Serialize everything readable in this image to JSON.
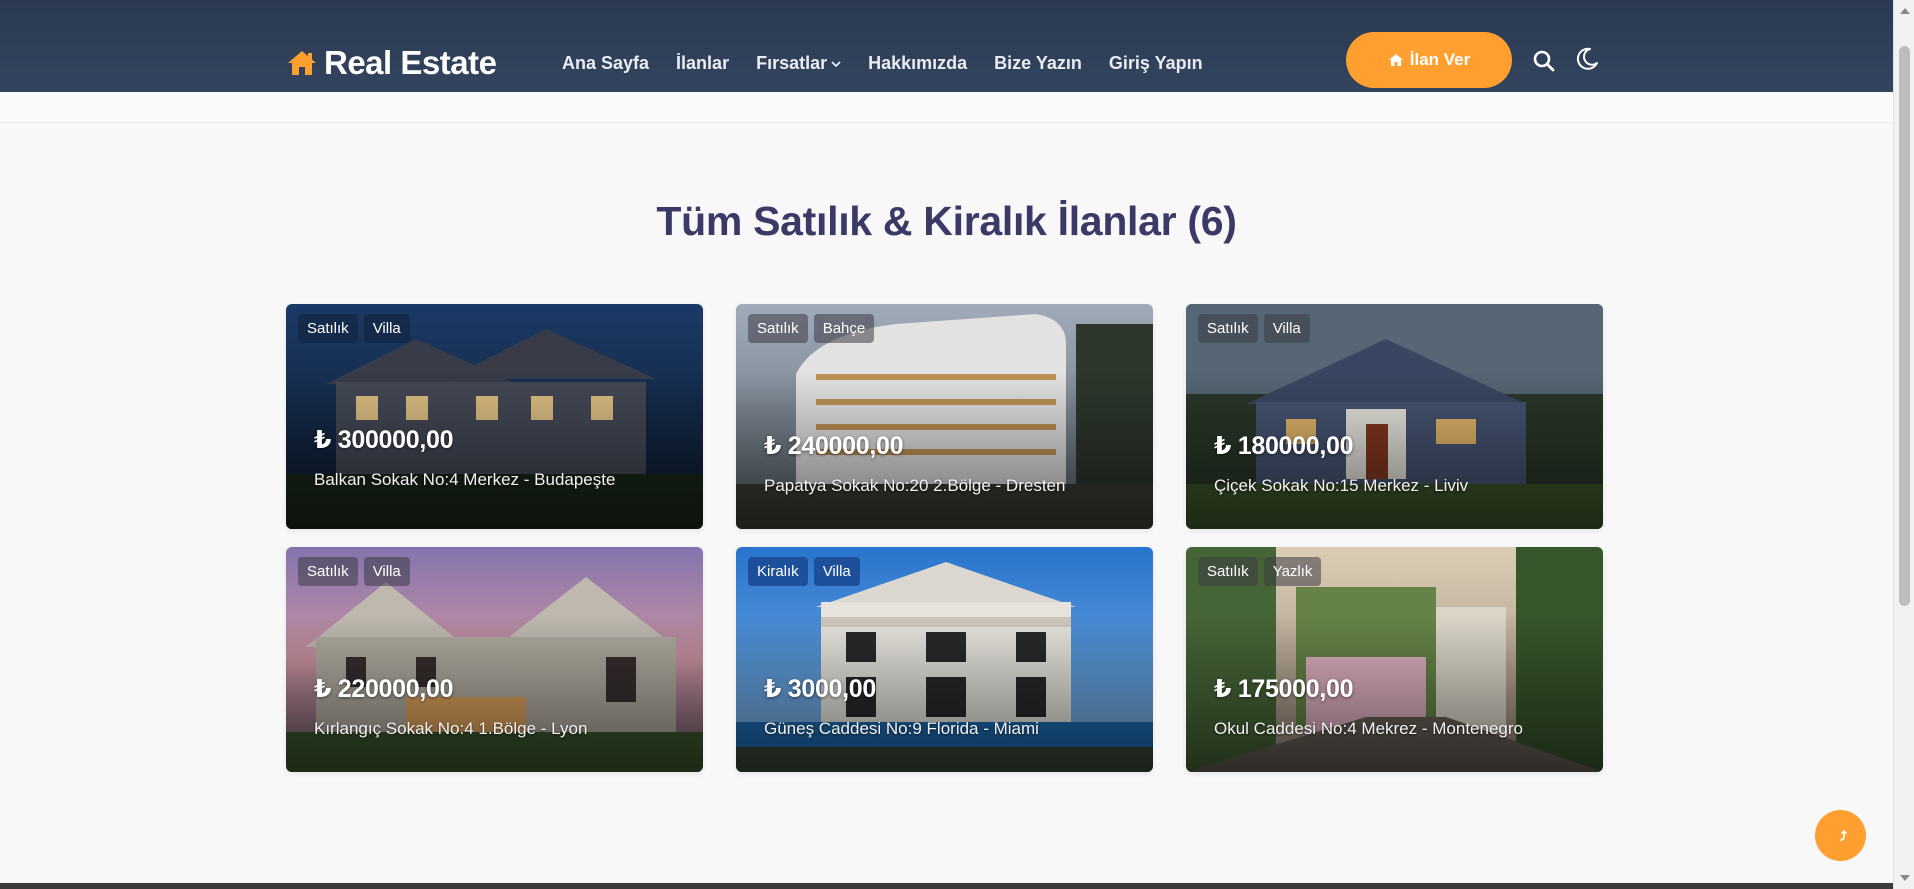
{
  "header": {
    "logo_text": "Real Estate",
    "nav": [
      {
        "label": "Ana Sayfa"
      },
      {
        "label": "İlanlar"
      },
      {
        "label": "Fırsatlar",
        "has_dropdown": true
      },
      {
        "label": "Hakkımızda"
      },
      {
        "label": "Bize Yazın"
      },
      {
        "label": "Giriş Yapın"
      }
    ],
    "cta_label": "İlan Ver",
    "icons": [
      "home-icon",
      "search-icon",
      "moon-icon"
    ]
  },
  "main": {
    "title": "Tüm Satılık & Kiralık İlanlar (6)"
  },
  "listings": [
    {
      "tags": [
        "Satılık",
        "Villa"
      ],
      "price": "₺ 300000,00",
      "address": "Balkan Sokak No:4 Merkez - Budapeşte"
    },
    {
      "tags": [
        "Satılık",
        "Bahçe"
      ],
      "price": "₺ 240000,00",
      "address": "Papatya Sokak No:20 2.Bölge - Dresten"
    },
    {
      "tags": [
        "Satılık",
        "Villa"
      ],
      "price": "₺ 180000,00",
      "address": "Çiçek Sokak No:15 Merkez - Liviv"
    },
    {
      "tags": [
        "Satılık",
        "Villa"
      ],
      "price": "₺ 220000,00",
      "address": "Kırlangıç Sokak No:4 1.Bölge - Lyon"
    },
    {
      "tags": [
        "Kiralık",
        "Villa"
      ],
      "price": "₺ 3000,00",
      "address": "Güneş Caddesi No:9 Florida - Miami"
    },
    {
      "tags": [
        "Satılık",
        "Yazlık"
      ],
      "price": "₺ 175000,00",
      "address": "Okul Caddesi No:4 Mekrez - Montenegro"
    }
  ],
  "colors": {
    "header_bg": "#2b3a52",
    "accent": "#ff9f2f",
    "title": "#3b3a66",
    "tag_blue": "#1d4f9a"
  }
}
